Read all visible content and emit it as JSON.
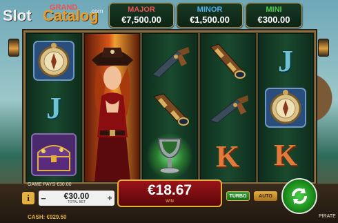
{
  "logo": {
    "part1": "Slot",
    "part2": "Catalog",
    "part3": ".com"
  },
  "jackpots": {
    "grand": {
      "title": "GRAND",
      "value": ""
    },
    "major": {
      "title": "MAJOR",
      "value": "€7,500.00",
      "title_color": "#f05050"
    },
    "minor": {
      "title": "MINOR",
      "value": "€1,500.00",
      "title_color": "#4fb0f0"
    },
    "mini": {
      "title": "MINI",
      "value": "€300.00",
      "title_color": "#50d050"
    }
  },
  "reels": [
    [
      "compass",
      "J",
      "treasure-chest"
    ],
    [
      "pirate-lady"
    ],
    [
      "flintlock-pistol",
      "spyglass",
      "goblet"
    ],
    [
      "spyglass",
      "flintlock-pistol",
      "K"
    ],
    [
      "J",
      "compass",
      "K"
    ]
  ],
  "bottom_bar": {
    "game_pays": "GAME PAYS €30.00",
    "bet_value": "€30.00",
    "bet_label": "TOTAL BET",
    "win_value": "€18.67",
    "win_label": "WIN",
    "turbo_label": "TURBO",
    "auto_label": "AUTO",
    "cash": "CASH: €929.50",
    "game_name": "PIRATE",
    "info_label": "i",
    "minus_label": "−",
    "plus_label": "+"
  },
  "colors": {
    "win_red": "#7a0c10",
    "button_green": "#2a8a2a",
    "gold": "#e4b040"
  }
}
